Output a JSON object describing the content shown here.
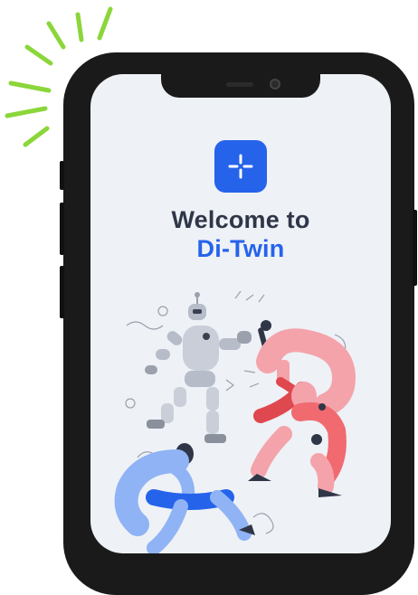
{
  "welcome": {
    "line1": "Welcome to",
    "line2": "Di-Twin"
  },
  "icons": {
    "app": "plus-sparkle-icon",
    "burst": "sparkle-burst-decoration",
    "illustration": "robot-and-dancers-illustration"
  },
  "colors": {
    "accent": "#2563eb",
    "heading": "#2f3648",
    "screen_bg": "#eef1f6",
    "burst": "#8bd63a",
    "phone_frame": "#1a1a1a"
  }
}
